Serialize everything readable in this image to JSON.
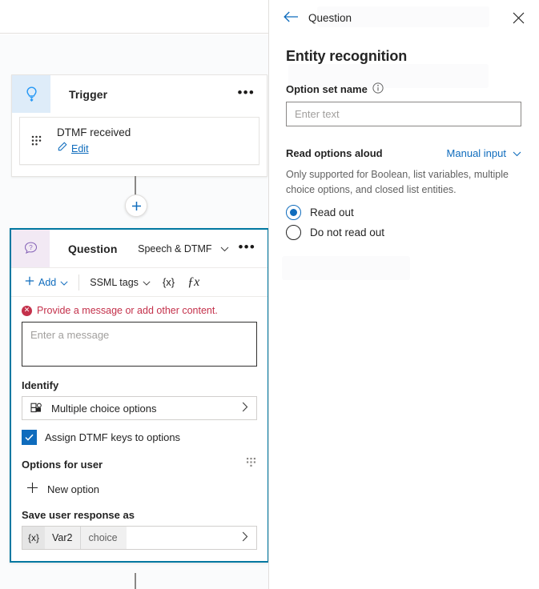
{
  "canvas": {
    "trigger_node": {
      "icon": "trigger-bolt-icon",
      "title": "Trigger",
      "menu": "•••",
      "subcard": {
        "handle_icon": "drag-dots-icon",
        "title": "DTMF received",
        "edit_icon": "pencil-icon",
        "edit_label": "Edit"
      }
    },
    "add_node_button": "+",
    "question_node": {
      "icon": "question-bubble-icon",
      "title": "Question",
      "mode": "Speech & DTMF",
      "mode_chevron": "⌄",
      "menu": "•••",
      "toolbar": {
        "add_label": "Add",
        "add_icon": "plus-icon",
        "add_chevron": "⌄",
        "ssml_label": "SSML tags",
        "ssml_chevron": "⌄",
        "variable_token": "{x}",
        "formula_token": "ƒx"
      },
      "error_message": "Provide a message or add other content.",
      "error_icon": "error-circle-icon",
      "message_placeholder": "Enter a message",
      "identify_label": "Identify",
      "identify_value": "Multiple choice options",
      "identify_icon": "multiple-choice-icon",
      "identify_chevron": "›",
      "assign_dtmf_label": "Assign DTMF keys to options",
      "assign_dtmf_checked": true,
      "options_for_user_label": "Options for user",
      "options_grid_icon": "grid-dots-icon",
      "new_option_label": "New option",
      "new_option_icon": "plus-icon",
      "save_response_label": "Save user response as",
      "variable": {
        "token": "{x}",
        "name": "Var2",
        "type": "choice",
        "chevron": "›"
      }
    }
  },
  "panel": {
    "back_icon": "back-arrow-icon",
    "back_label": "Question",
    "close_icon": "close-icon",
    "title": "Entity recognition",
    "option_set": {
      "label": "Option set name",
      "info_icon": "info-icon",
      "value": "",
      "placeholder": "Enter text"
    },
    "read_aloud": {
      "label": "Read options aloud",
      "input_mode": "Manual input",
      "input_mode_chevron": "⌄",
      "help_text": "Only supported for Boolean, list variables, multiple choice options, and closed list entities.",
      "options": [
        {
          "label": "Read out",
          "selected": true
        },
        {
          "label": "Do not read out",
          "selected": false
        }
      ]
    }
  },
  "colors": {
    "accent_blue": "#0f6cbd",
    "selected_border": "#0078a1",
    "error_red": "#c4314b",
    "trigger_icon_bg": "#deecf9",
    "question_icon_bg": "#f2e9f4",
    "question_icon": "#8764b8"
  }
}
